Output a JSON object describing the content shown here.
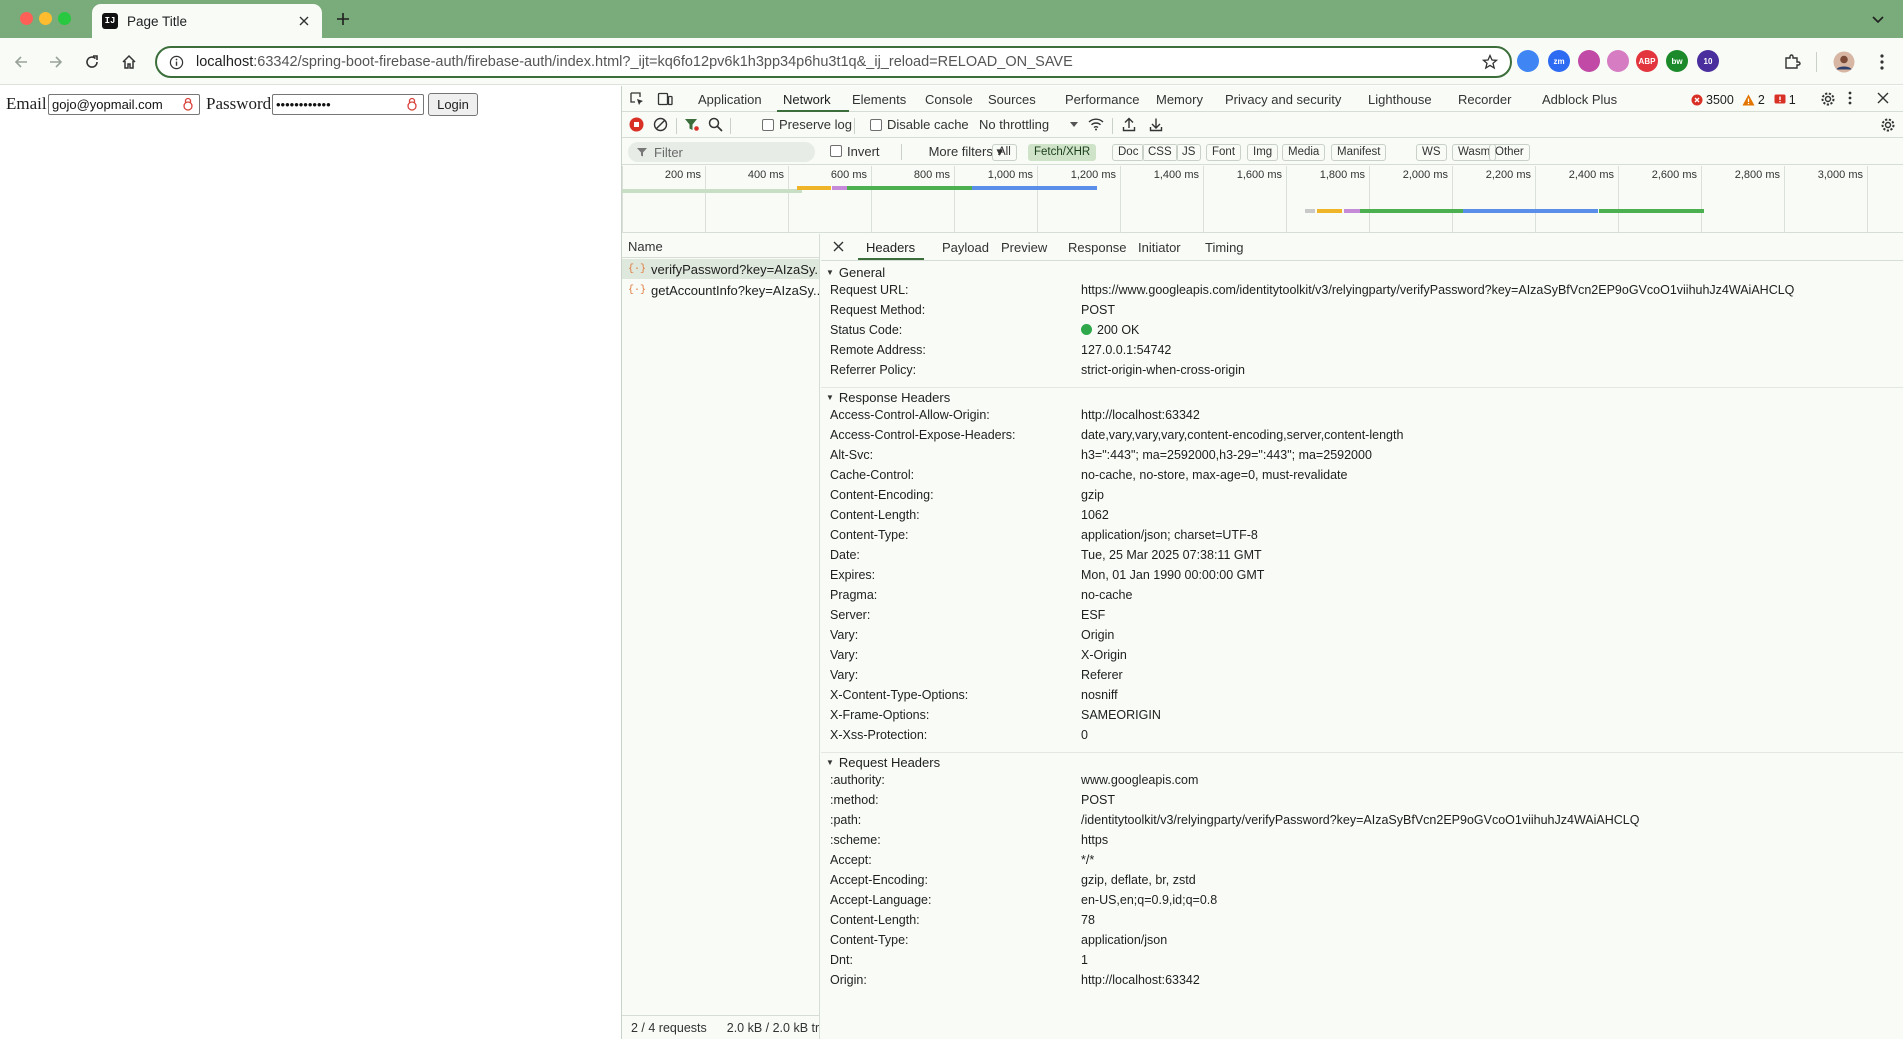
{
  "browser": {
    "tab_title": "Page Title",
    "tab_favicon_text": "IJ",
    "url_host": "localhost",
    "url_rest": ":63342/spring-boot-firebase-auth/firebase-auth/index.html?_ijt=kq6fo12pv6k1h3pp34p6hu3t1q&_ij_reload=RELOAD_ON_SAVE",
    "extensions": [
      {
        "name": "edge-icon",
        "color": "#3f86f4",
        "text": ""
      },
      {
        "name": "zoom-icon",
        "color": "#2d6bf3",
        "text": "zm"
      },
      {
        "name": "colorzilla-icon",
        "color": "#c04aa5",
        "text": ""
      },
      {
        "name": "ext-icon",
        "color": "#d57cc3",
        "text": ""
      },
      {
        "name": "adblock-plus-icon",
        "color": "#e2353d",
        "text": "ABP"
      },
      {
        "name": "bw-icon",
        "color": "#1c8a2a",
        "text": "bw"
      },
      {
        "name": "ext-badge-icon",
        "color": "#4a2e9e",
        "text": "10"
      }
    ]
  },
  "page": {
    "email_label": "Email",
    "email_value": "gojo@yopmail.com",
    "password_label": "Password",
    "password_value": "••••••••••••",
    "login_label": "Login"
  },
  "devtools": {
    "tabs": [
      "Application",
      "Network",
      "Elements",
      "Console",
      "Sources",
      "Performance",
      "Memory",
      "Privacy and security",
      "Lighthouse",
      "Recorder",
      "Adblock Plus"
    ],
    "active_tab": "Network",
    "errors_count": "3500",
    "warnings_count": "2",
    "issues_count": "1",
    "preserve_log": "Preserve log",
    "disable_cache": "Disable cache",
    "throttling": "No throttling",
    "filter_placeholder": "Filter",
    "invert": "Invert",
    "more_filters": "More filters",
    "filter_chips": [
      "All",
      "Fetch/XHR",
      "Doc",
      "CSS",
      "JS",
      "Font",
      "Img",
      "Media",
      "Manifest",
      "WS",
      "Wasm",
      "Other"
    ],
    "active_chip": "Fetch/XHR",
    "timeline_ticks": [
      "200 ms",
      "400 ms",
      "600 ms",
      "800 ms",
      "1,000 ms",
      "1,200 ms",
      "1,400 ms",
      "1,600 ms",
      "1,800 ms",
      "2,000 ms",
      "2,200 ms",
      "2,400 ms",
      "2,600 ms",
      "2,800 ms",
      "3,000 ms"
    ],
    "list_header": "Name",
    "requests": [
      {
        "name": "verifyPassword?key=AIzaSy...",
        "selected": true
      },
      {
        "name": "getAccountInfo?key=AIzaSy...",
        "selected": false
      }
    ],
    "footer_requests": "2 / 4 requests",
    "footer_transfer": "2.0 kB / 2.0 kB tr",
    "detail_tabs": [
      "Headers",
      "Payload",
      "Preview",
      "Response",
      "Initiator",
      "Timing"
    ],
    "active_detail_tab": "Headers",
    "general_title": "General",
    "general": [
      {
        "k": "Request URL:",
        "v": "https://www.googleapis.com/identitytoolkit/v3/relyingparty/verifyPassword?key=AIzaSyBfVcn2EP9oGVcoO1viihuhJz4WAiAHCLQ"
      },
      {
        "k": "Request Method:",
        "v": "POST"
      },
      {
        "k": "Status Code:",
        "v": "200 OK",
        "dot": true
      },
      {
        "k": "Remote Address:",
        "v": "127.0.0.1:54742"
      },
      {
        "k": "Referrer Policy:",
        "v": "strict-origin-when-cross-origin"
      }
    ],
    "response_title": "Response Headers",
    "response_headers": [
      {
        "k": "Access-Control-Allow-Origin:",
        "v": "http://localhost:63342"
      },
      {
        "k": "Access-Control-Expose-Headers:",
        "v": "date,vary,vary,vary,content-encoding,server,content-length"
      },
      {
        "k": "Alt-Svc:",
        "v": "h3=\":443\"; ma=2592000,h3-29=\":443\"; ma=2592000"
      },
      {
        "k": "Cache-Control:",
        "v": "no-cache, no-store, max-age=0, must-revalidate"
      },
      {
        "k": "Content-Encoding:",
        "v": "gzip"
      },
      {
        "k": "Content-Length:",
        "v": "1062"
      },
      {
        "k": "Content-Type:",
        "v": "application/json; charset=UTF-8"
      },
      {
        "k": "Date:",
        "v": "Tue, 25 Mar 2025 07:38:11 GMT"
      },
      {
        "k": "Expires:",
        "v": "Mon, 01 Jan 1990 00:00:00 GMT"
      },
      {
        "k": "Pragma:",
        "v": "no-cache"
      },
      {
        "k": "Server:",
        "v": "ESF"
      },
      {
        "k": "Vary:",
        "v": "Origin"
      },
      {
        "k": "Vary:",
        "v": "X-Origin"
      },
      {
        "k": "Vary:",
        "v": "Referer"
      },
      {
        "k": "X-Content-Type-Options:",
        "v": "nosniff"
      },
      {
        "k": "X-Frame-Options:",
        "v": "SAMEORIGIN"
      },
      {
        "k": "X-Xss-Protection:",
        "v": "0"
      }
    ],
    "request_title": "Request Headers",
    "request_headers": [
      {
        "k": ":authority:",
        "v": "www.googleapis.com"
      },
      {
        "k": ":method:",
        "v": "POST"
      },
      {
        "k": ":path:",
        "v": "/identitytoolkit/v3/relyingparty/verifyPassword?key=AIzaSyBfVcn2EP9oGVcoO1viihuhJz4WAiAHCLQ"
      },
      {
        "k": ":scheme:",
        "v": "https"
      },
      {
        "k": "Accept:",
        "v": "*/*"
      },
      {
        "k": "Accept-Encoding:",
        "v": "gzip, deflate, br, zstd"
      },
      {
        "k": "Accept-Language:",
        "v": "en-US,en;q=0.9,id;q=0.8"
      },
      {
        "k": "Content-Length:",
        "v": "78"
      },
      {
        "k": "Content-Type:",
        "v": "application/json"
      },
      {
        "k": "Dnt:",
        "v": "1"
      },
      {
        "k": "Origin:",
        "v": "http://localhost:63342"
      }
    ]
  }
}
